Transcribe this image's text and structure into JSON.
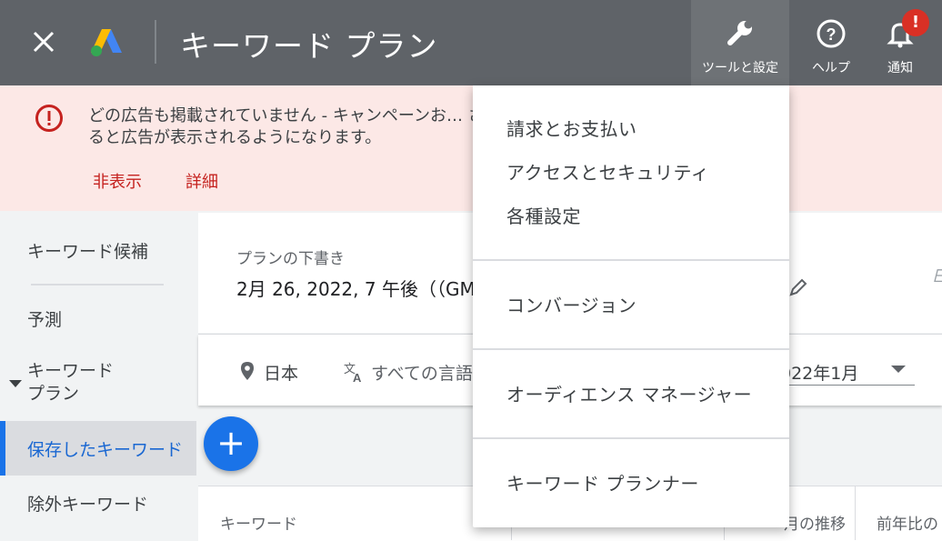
{
  "header": {
    "title": "キーワード プラン",
    "tools_label": "ツールと設定",
    "help_label": "ヘルプ",
    "notifications_label": "通知",
    "notification_badge": "!",
    "colors": {
      "bar": "#5f6368",
      "badge": "#d93025"
    }
  },
  "banner": {
    "line1": "どの広告も掲載されていません - キャンペーンお… されています。有効",
    "line2": "ると広告が表示されるようになります。",
    "hide_label": "非表示",
    "details_label": "詳細"
  },
  "sidebar": {
    "items": [
      {
        "label": "キーワード候補"
      },
      {
        "label": "予測"
      },
      {
        "label": "キーワード プラン"
      },
      {
        "label": "保存したキーワード",
        "active": true
      },
      {
        "label": "除外キーワード"
      }
    ]
  },
  "main": {
    "plan_caption": "プランの下書き",
    "plan_name": "2月 26, 2022, 7 午後（（GM",
    "location": "日本",
    "language": "すべての言語",
    "date_range": "022年1月",
    "add_label": "+",
    "columns": [
      "キーワード",
      "月の推移",
      "前年比の"
    ]
  },
  "menu": {
    "items": [
      "請求とお支払い",
      "アクセスとセキュリティ",
      "各種設定",
      "コンバージョン",
      "オーディエンス マネージャー",
      "キーワード プランナー"
    ]
  }
}
